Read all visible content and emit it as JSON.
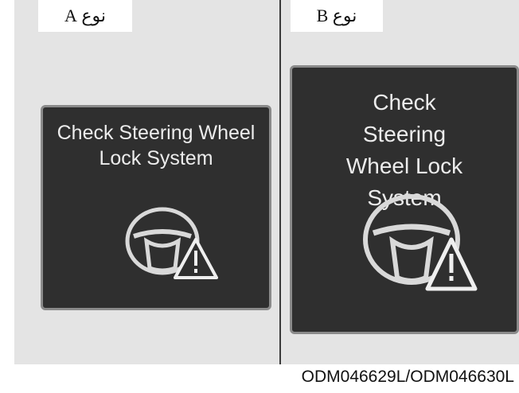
{
  "type_a": {
    "tag": "نوع A",
    "message": "Check Steering Wheel Lock System"
  },
  "type_b": {
    "tag": "نوع B",
    "message": "Check Steering Wheel Lock System"
  },
  "figure_code": "ODM046629L/ODM046630L",
  "icons": {
    "steering": "steering-wheel-icon",
    "warning": "warning-triangle-icon"
  },
  "colors": {
    "display_bg": "#2f2f2f",
    "display_border": "#8a8a8a",
    "text": "#ececec",
    "page_bg": "#e4e4e4"
  }
}
